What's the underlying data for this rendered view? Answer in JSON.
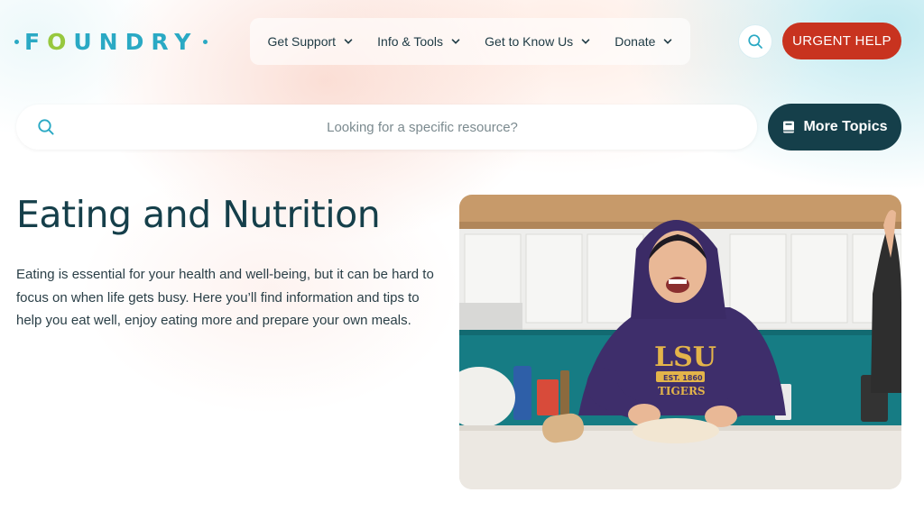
{
  "brand": {
    "logo_text_a": "F",
    "logo_text_o1": "O",
    "logo_text_b": "UNDR",
    "logo_text_c": "Y"
  },
  "nav": {
    "items": [
      {
        "label": "Get Support"
      },
      {
        "label": "Info & Tools"
      },
      {
        "label": "Get to Know Us"
      },
      {
        "label": "Donate"
      }
    ]
  },
  "header": {
    "urgent_label": "URGENT HELP"
  },
  "search": {
    "placeholder": "Looking for a specific resource?",
    "more_topics_label": "More Topics"
  },
  "hero": {
    "title": "Eating and Nutrition",
    "description": "Eating is essential for your health and well-being, but it can be hard to focus on when life gets busy. Here you’ll find information and tips to help you eat well, enjoy eating more and prepare your own meals."
  },
  "photo": {
    "hoodie_text": "LSU",
    "hoodie_badge": "EST. 1860",
    "hoodie_sub": "TIGERS"
  },
  "colors": {
    "brand_teal": "#2aa9c4",
    "brand_green": "#97c83e",
    "urgent_red": "#c8331f",
    "dark_teal": "#153f4a"
  }
}
